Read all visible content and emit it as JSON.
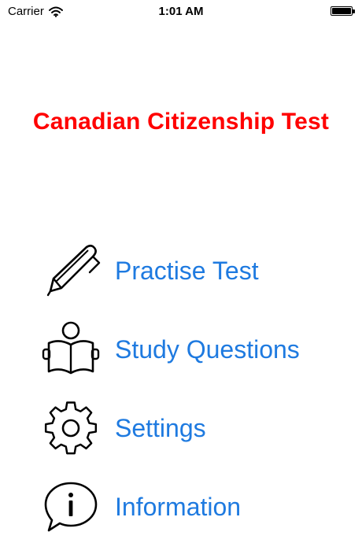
{
  "status_bar": {
    "carrier": "Carrier",
    "time": "1:01 AM",
    "wifi_icon": "wifi-icon",
    "battery_icon": "battery-icon"
  },
  "app": {
    "title": "Canadian Citizenship Test",
    "title_color": "#ff0000",
    "accent_color": "#1e7ae0"
  },
  "menu": {
    "items": [
      {
        "label": "Practise Test",
        "icon": "pen-icon"
      },
      {
        "label": "Study Questions",
        "icon": "reading-person-icon"
      },
      {
        "label": "Settings",
        "icon": "gear-icon"
      },
      {
        "label": "Information",
        "icon": "info-bubble-icon"
      }
    ]
  }
}
